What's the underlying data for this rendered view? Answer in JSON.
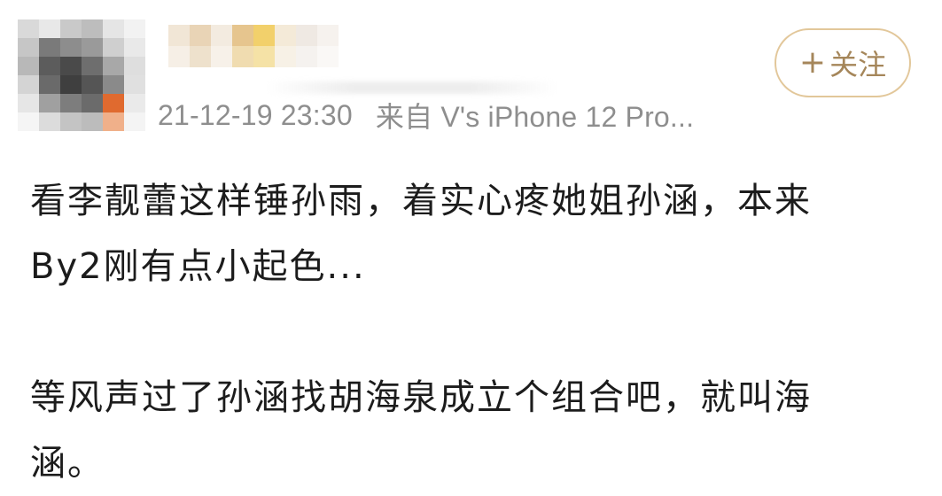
{
  "header": {
    "timestamp": "21-12-19 23:30",
    "source": "来自 V's iPhone 12 Pro...",
    "follow_label": "关注",
    "follow_icon": "plus-icon"
  },
  "avatar": {
    "style": "mosaic-blurred",
    "colors": [
      "#d9d9d9",
      "#e8e8e8",
      "#c9c9c9",
      "#bdbdbd",
      "#e5e5e5",
      "#f2f2f2",
      "#c6c6c6",
      "#7a7a7a",
      "#8d8d8d",
      "#9a9a9a",
      "#cfcfcf",
      "#e9e9e9",
      "#b8b8b8",
      "#5c5c5c",
      "#4a4a4a",
      "#6e6e6e",
      "#a8a8a8",
      "#dedede",
      "#d4d4d4",
      "#6a6a6a",
      "#3f3f3f",
      "#555555",
      "#8a8a8a",
      "#e0e0e0",
      "#e6e6e6",
      "#a0a0a0",
      "#7d7d7d",
      "#6b6b6b",
      "#e06a2f",
      "#eaeaea",
      "#f5f5f5",
      "#dcdcdc",
      "#c4c4c4",
      "#bcbcbc",
      "#f0b08a",
      "#f4f4f4"
    ]
  },
  "username": {
    "style": "mosaic-blurred",
    "colors": [
      "#f1e6d6",
      "#e9d4b6",
      "#f3ebe0",
      "#e6c58e",
      "#f2d06b",
      "#f4ead8",
      "#efe9e3",
      "#f6f2ee",
      "#f6efe6",
      "#eee1cc",
      "#f7f1e9",
      "#f0dcb0",
      "#f5e2a6",
      "#f7f1e6",
      "#f5f2ef",
      "#faf8f6"
    ]
  },
  "post": {
    "paragraph_1": [
      "看李靓蕾这样锤孙雨，着实心疼她姐孙涵，本来",
      "By2刚有点小起色..."
    ],
    "paragraph_2": [
      "等风声过了孙涵找胡海泉成立个组合吧，就叫海",
      "涵。"
    ]
  },
  "colors": {
    "follow_border": "#e2c79a",
    "follow_text": "#a5865a",
    "meta_text": "#8e8e8e",
    "body_text": "#1c1c1c"
  }
}
